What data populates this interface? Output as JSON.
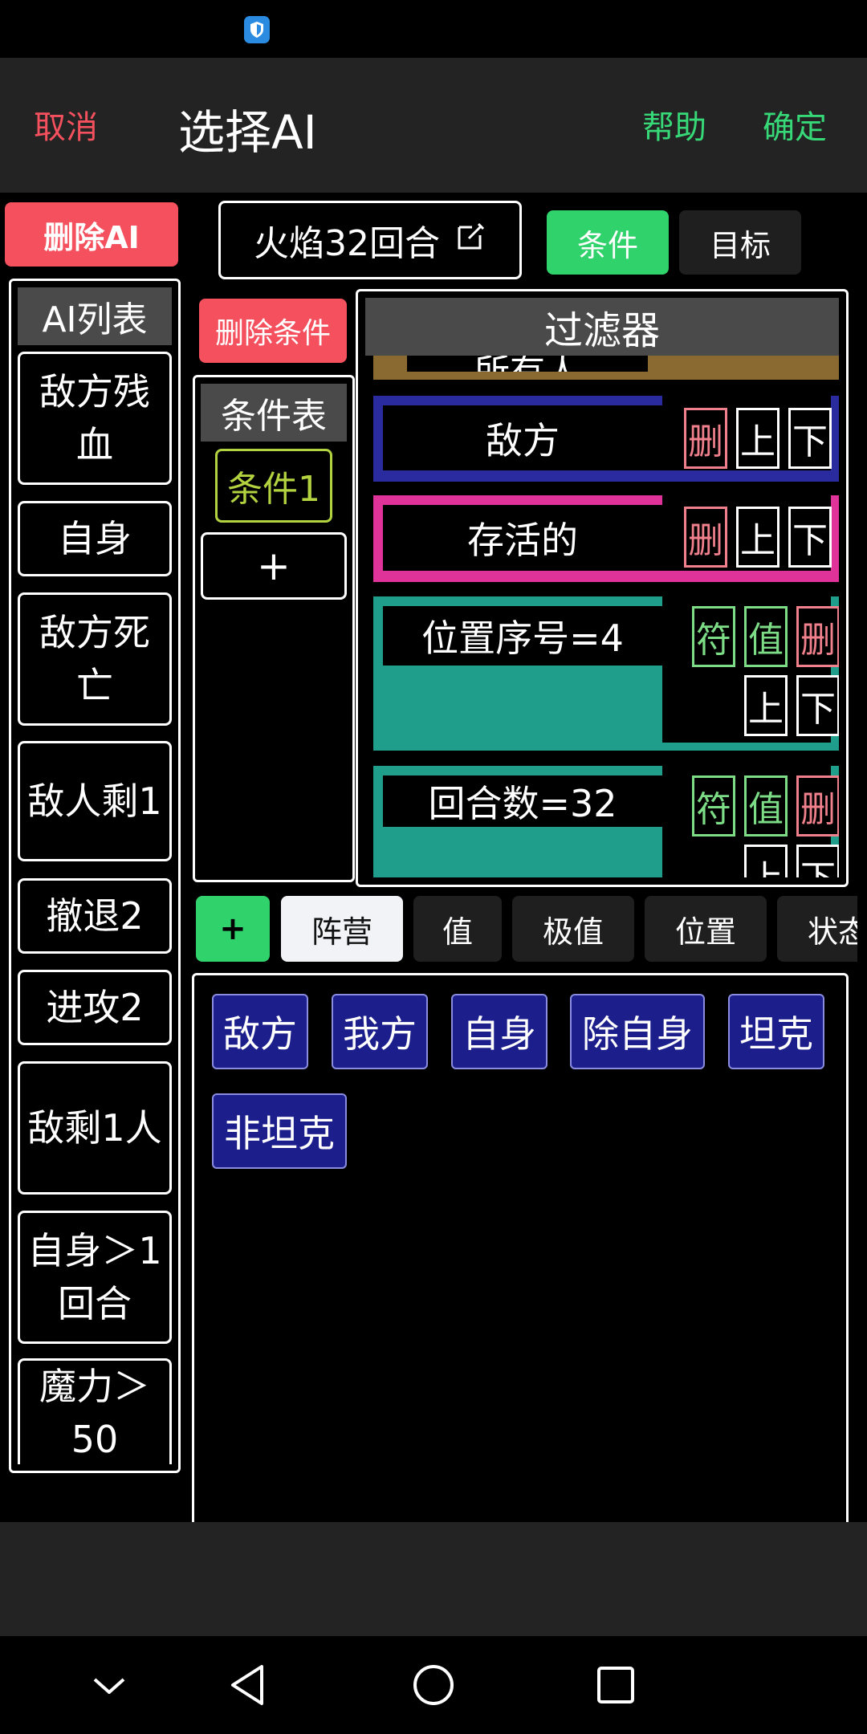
{
  "header": {
    "cancel_label": "取消",
    "title": "选择AI",
    "help_label": "帮助",
    "confirm_label": "确定"
  },
  "toolbar": {
    "delete_ai_label": "删除AI",
    "ai_name": "火焰32回合",
    "tabs": [
      "条件",
      "目标"
    ]
  },
  "ai_list": {
    "header": "AI列表",
    "items": [
      "敌方残血",
      "自身",
      "敌方死亡",
      "敌人剩1",
      "撤退2",
      "进攻2",
      "敌剩1人",
      "自身＞1回合",
      "魔力＞50"
    ]
  },
  "conditions": {
    "delete_label": "删除条件",
    "header": "条件表",
    "items": [
      "条件1"
    ],
    "add_label": "+"
  },
  "filter": {
    "header": "过滤器",
    "partial_top_label": "所有人",
    "rows": [
      {
        "label": "敌方",
        "color": "#2b2ba0"
      },
      {
        "label": "存活的",
        "color": "#e0339a"
      },
      {
        "label": "位置序号=4",
        "color": "#1f9e8c"
      },
      {
        "label": "回合数=32",
        "color": "#1f9e8c"
      }
    ],
    "btn_delete": "删",
    "btn_up": "上",
    "btn_down": "下",
    "btn_symbol": "符",
    "btn_value": "值"
  },
  "categories": {
    "add_label": "+",
    "items": [
      "阵营",
      "值",
      "极值",
      "位置",
      "状态"
    ],
    "active": "阵营"
  },
  "options": [
    "敌方",
    "我方",
    "自身",
    "除自身",
    "坦克",
    "非坦克"
  ],
  "colors": {
    "accent_green": "#2fd26b",
    "accent_red": "#f4505e",
    "option_blue": "#1c1e8c"
  }
}
